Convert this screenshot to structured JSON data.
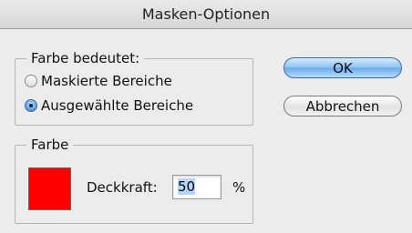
{
  "window": {
    "title": "Masken-Optionen"
  },
  "color_meaning": {
    "legend": "Farbe bedeutet:",
    "options": [
      {
        "label": "Maskierte Bereiche",
        "checked": false
      },
      {
        "label": "Ausgewählte Bereiche",
        "checked": true
      }
    ]
  },
  "color": {
    "legend": "Farbe",
    "swatch_color": "#ff0000",
    "opacity_label": "Deckkraft:",
    "opacity_value": "50",
    "opacity_unit": "%"
  },
  "buttons": {
    "ok": "OK",
    "cancel": "Abbrechen"
  }
}
